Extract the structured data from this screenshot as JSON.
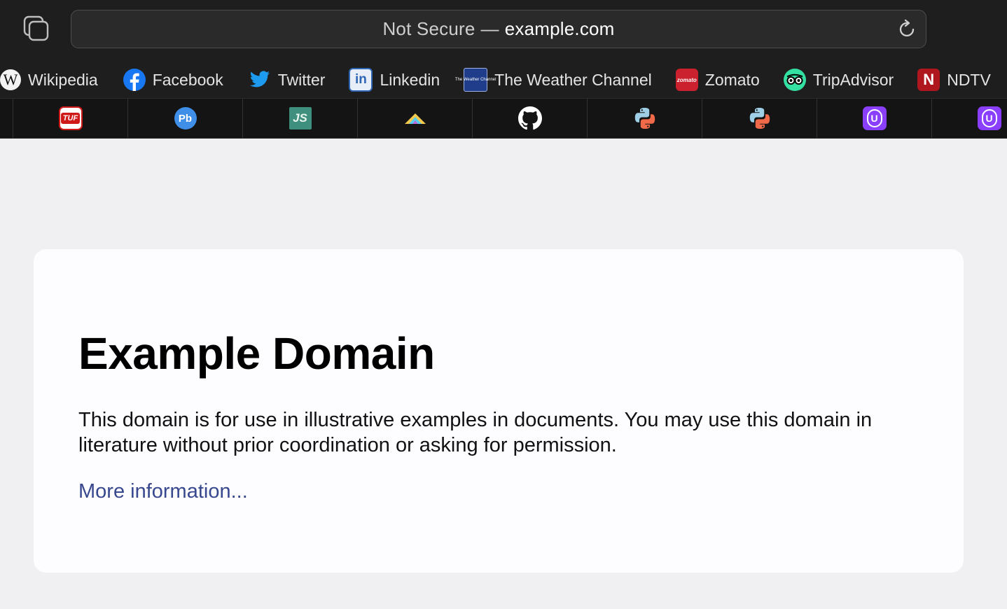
{
  "address_bar": {
    "security": "Not Secure",
    "separator": "—",
    "host": "example.com"
  },
  "favorites": [
    {
      "label": "Wikipedia",
      "icon": "wikipedia-icon"
    },
    {
      "label": "Facebook",
      "icon": "facebook-icon"
    },
    {
      "label": "Twitter",
      "icon": "twitter-icon"
    },
    {
      "label": "Linkedin",
      "icon": "linkedin-icon"
    },
    {
      "label": "The Weather Channel",
      "icon": "weather-channel-icon"
    },
    {
      "label": "Zomato",
      "icon": "zomato-icon"
    },
    {
      "label": "TripAdvisor",
      "icon": "tripadvisor-icon"
    },
    {
      "label": "NDTV",
      "icon": "ndtv-icon"
    }
  ],
  "tab_icons": {
    "tab1": "tuf-icon",
    "tab2": "pb-icon",
    "tab3": "jf-icon",
    "tab4": "mountain-icon",
    "tab5": "github-icon",
    "tab6": "python-icon",
    "tab7": "python-icon",
    "tab8": "u-shield-icon",
    "tab9": "u-shield-icon"
  },
  "icon_text": {
    "wikipedia": "W",
    "linkedin": "in",
    "weather": "The Weather Channel",
    "zomato": "zomato",
    "ndtv": "N",
    "tuf": "TUF",
    "pb": "Pb",
    "jf": "JS",
    "u": "U"
  },
  "page": {
    "title": "Example Domain",
    "body": "This domain is for use in illustrative examples in documents. You may use this domain in literature without prior coordination or asking for permission.",
    "link": "More information..."
  },
  "colors": {
    "toolbar_bg": "#1e1e1e",
    "page_bg": "#f0f0f2",
    "card_bg": "#fdfdff",
    "link": "#38488f",
    "facebook": "#1877f2",
    "twitter": "#1d9bf0",
    "linkedin": "#2f66b3",
    "weather": "#1f3d8a",
    "zomato": "#cb202d",
    "tripadvisor": "#34e0a1",
    "ndtv": "#b0161e",
    "u_purple": "#8a3ffc"
  }
}
